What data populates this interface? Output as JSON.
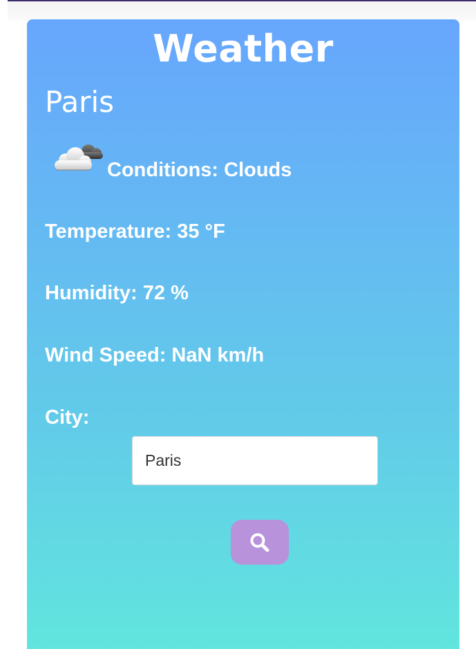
{
  "app": {
    "title": "Weather"
  },
  "weather": {
    "city": "Paris",
    "conditions": "Conditions: Clouds",
    "conditions_icon": "clouds-icon",
    "temperature": "Temperature: 35 °F",
    "humidity": "Humidity: 72 %",
    "wind_speed": "Wind Speed: NaN km/h"
  },
  "search": {
    "label": "City:",
    "value": "Paris",
    "button_icon": "search-icon"
  },
  "colors": {
    "gradient_top": "#67a6fd",
    "gradient_bottom": "#61e5de",
    "button": "#b892db",
    "text": "#ffffff"
  }
}
